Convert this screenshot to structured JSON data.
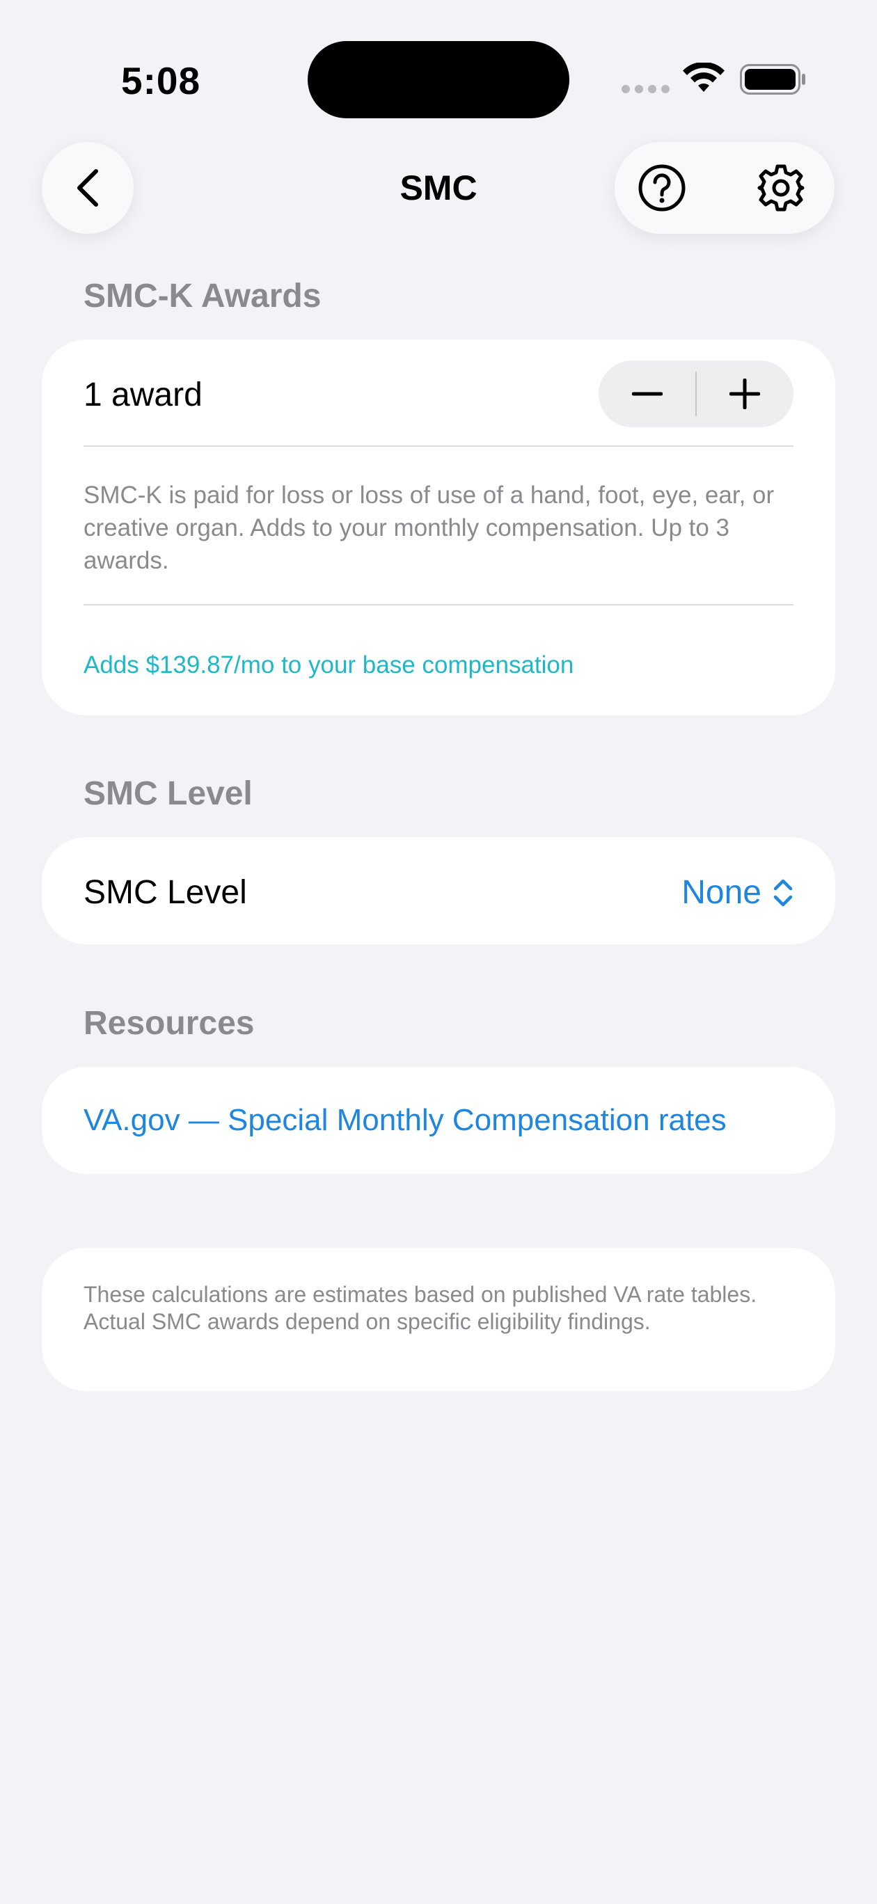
{
  "status_bar": {
    "time": "5:08"
  },
  "nav": {
    "title": "SMC",
    "back_icon": "chevron-left-icon",
    "help_icon": "question-circle-icon",
    "settings_icon": "gear-icon"
  },
  "smck": {
    "header": "SMC-K Awards",
    "award_label": "1 award",
    "award_count": 1,
    "description": "SMC-K is paid for loss or loss of use of a hand, foot, eye, ear, or creative organ. Adds to your monthly compensation. Up to 3 awards.",
    "adds_text": "Adds $139.87/mo to your base compensation"
  },
  "smc_level": {
    "header": "SMC Level",
    "label": "SMC Level",
    "value": "None"
  },
  "resources": {
    "header": "Resources",
    "link": "VA.gov — Special Monthly Compensation rates"
  },
  "disclaimer": {
    "text": "These calculations are estimates based on published VA rate tables. Actual SMC awards depend on specific eligibility findings."
  },
  "colors": {
    "background": "#f2f2f7",
    "accent_blue": "#1f86e0",
    "accent_teal": "#1fb8c9",
    "secondary_text": "#8a8a8e"
  }
}
